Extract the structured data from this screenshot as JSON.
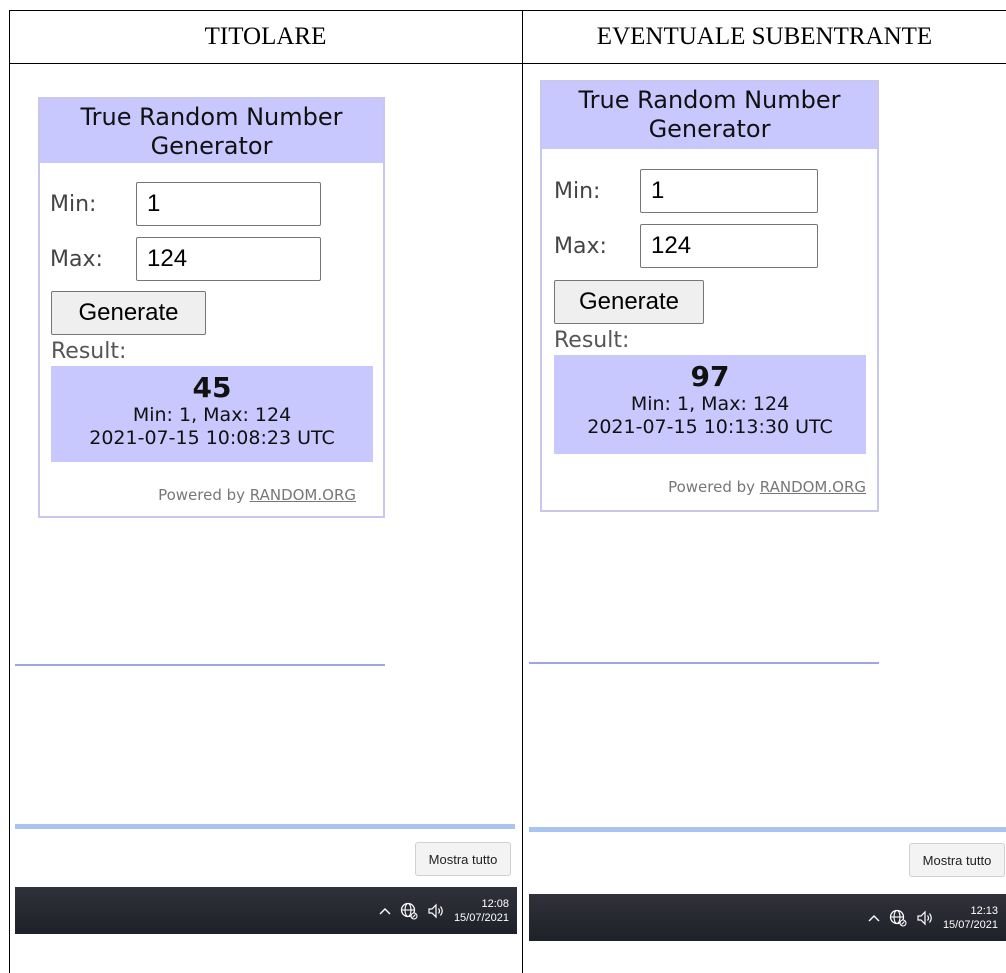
{
  "columns": {
    "left_header": "TITOLARE",
    "right_header": "EVENTUALE SUBENTRANTE"
  },
  "left_panel": {
    "widget_title": "True Random Number Generator",
    "min_label": "Min:",
    "min_value": "1",
    "max_label": "Max:",
    "max_value": "124",
    "generate_label": "Generate",
    "result_label": "Result:",
    "result_value": "45",
    "result_range": "Min: 1, Max: 124",
    "result_timestamp": "2021-07-15 10:08:23 UTC",
    "powered_prefix": "Powered by ",
    "powered_link": "RANDOM.ORG",
    "show_all_label": "Mostra tutto",
    "clock_time": "12:08",
    "clock_date": "15/07/2021"
  },
  "right_panel": {
    "widget_title": "True Random Number Generator",
    "min_label": "Min:",
    "min_value": "1",
    "max_label": "Max:",
    "max_value": "124",
    "generate_label": "Generate",
    "result_label": "Result:",
    "result_value": "97",
    "result_range": "Min: 1, Max: 124",
    "result_timestamp": "2021-07-15 10:13:30 UTC",
    "powered_prefix": "Powered by ",
    "powered_link": "RANDOM.ORG",
    "show_all_label": "Mostra tutto",
    "clock_time": "12:13",
    "clock_date": "15/07/2021"
  },
  "colors": {
    "widget_accent": "#c8c8ff",
    "taskbar": "#26272e",
    "divider_rule": "#9aa6e6",
    "bottom_rule": "#a9c4f0"
  },
  "icons": [
    "chevron-up-icon",
    "network-icon",
    "speaker-icon"
  ]
}
